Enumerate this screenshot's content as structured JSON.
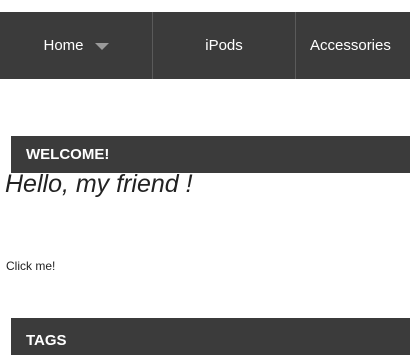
{
  "nav": {
    "items": [
      {
        "label": "Home",
        "has_dropdown": true
      },
      {
        "label": "iPods",
        "has_dropdown": false
      },
      {
        "label": "Accessories",
        "has_dropdown": false
      }
    ]
  },
  "welcome": {
    "heading": "WELCOME!",
    "greeting": "Hello, my friend !",
    "link": "Click me!"
  },
  "tags": {
    "heading": "TAGS"
  },
  "colors": {
    "bar_background": "#3b3b3b",
    "bar_text": "#ffffff",
    "caret": "#9a9a9a",
    "body_text": "#222222"
  }
}
